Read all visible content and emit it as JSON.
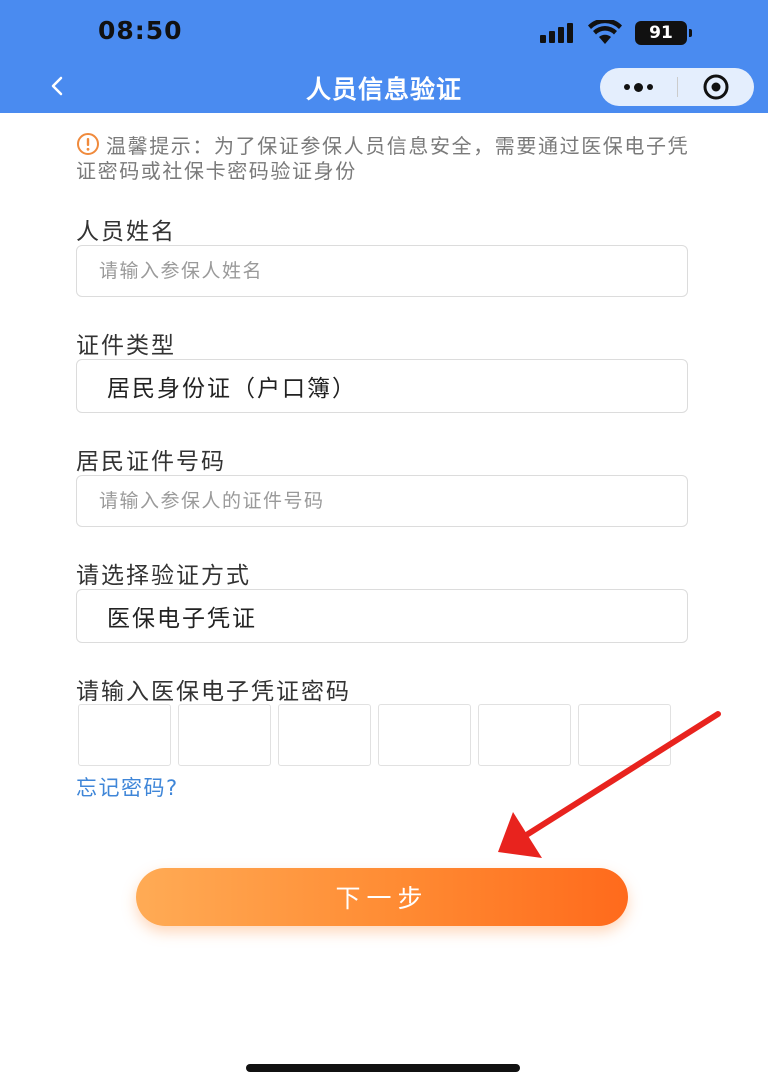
{
  "status": {
    "time": "08:50",
    "battery": "91"
  },
  "nav": {
    "title": "人员信息验证"
  },
  "tip": {
    "text": "温馨提示：为了保证参保人员信息安全，需要通过医保电子凭证密码或社保卡密码验证身份"
  },
  "form": {
    "name": {
      "label": "人员姓名",
      "placeholder": "请输入参保人姓名"
    },
    "id_type": {
      "label": "证件类型",
      "value": "居民身份证（户口簿）"
    },
    "id_number": {
      "label": "居民证件号码",
      "placeholder": "请输入参保人的证件号码"
    },
    "verify_method": {
      "label": "请选择验证方式",
      "value": "医保电子凭证"
    },
    "password": {
      "label": "请输入医保电子凭证密码"
    }
  },
  "forgot_link": "忘记密码?",
  "next_button": "下一步",
  "colors": {
    "nav_bg": "#4a8bf0",
    "accent_orange": "#ff7a2a",
    "link_blue": "#3f86d8",
    "warning_icon": "#f08a3c",
    "annotation_arrow": "#e8231e"
  }
}
